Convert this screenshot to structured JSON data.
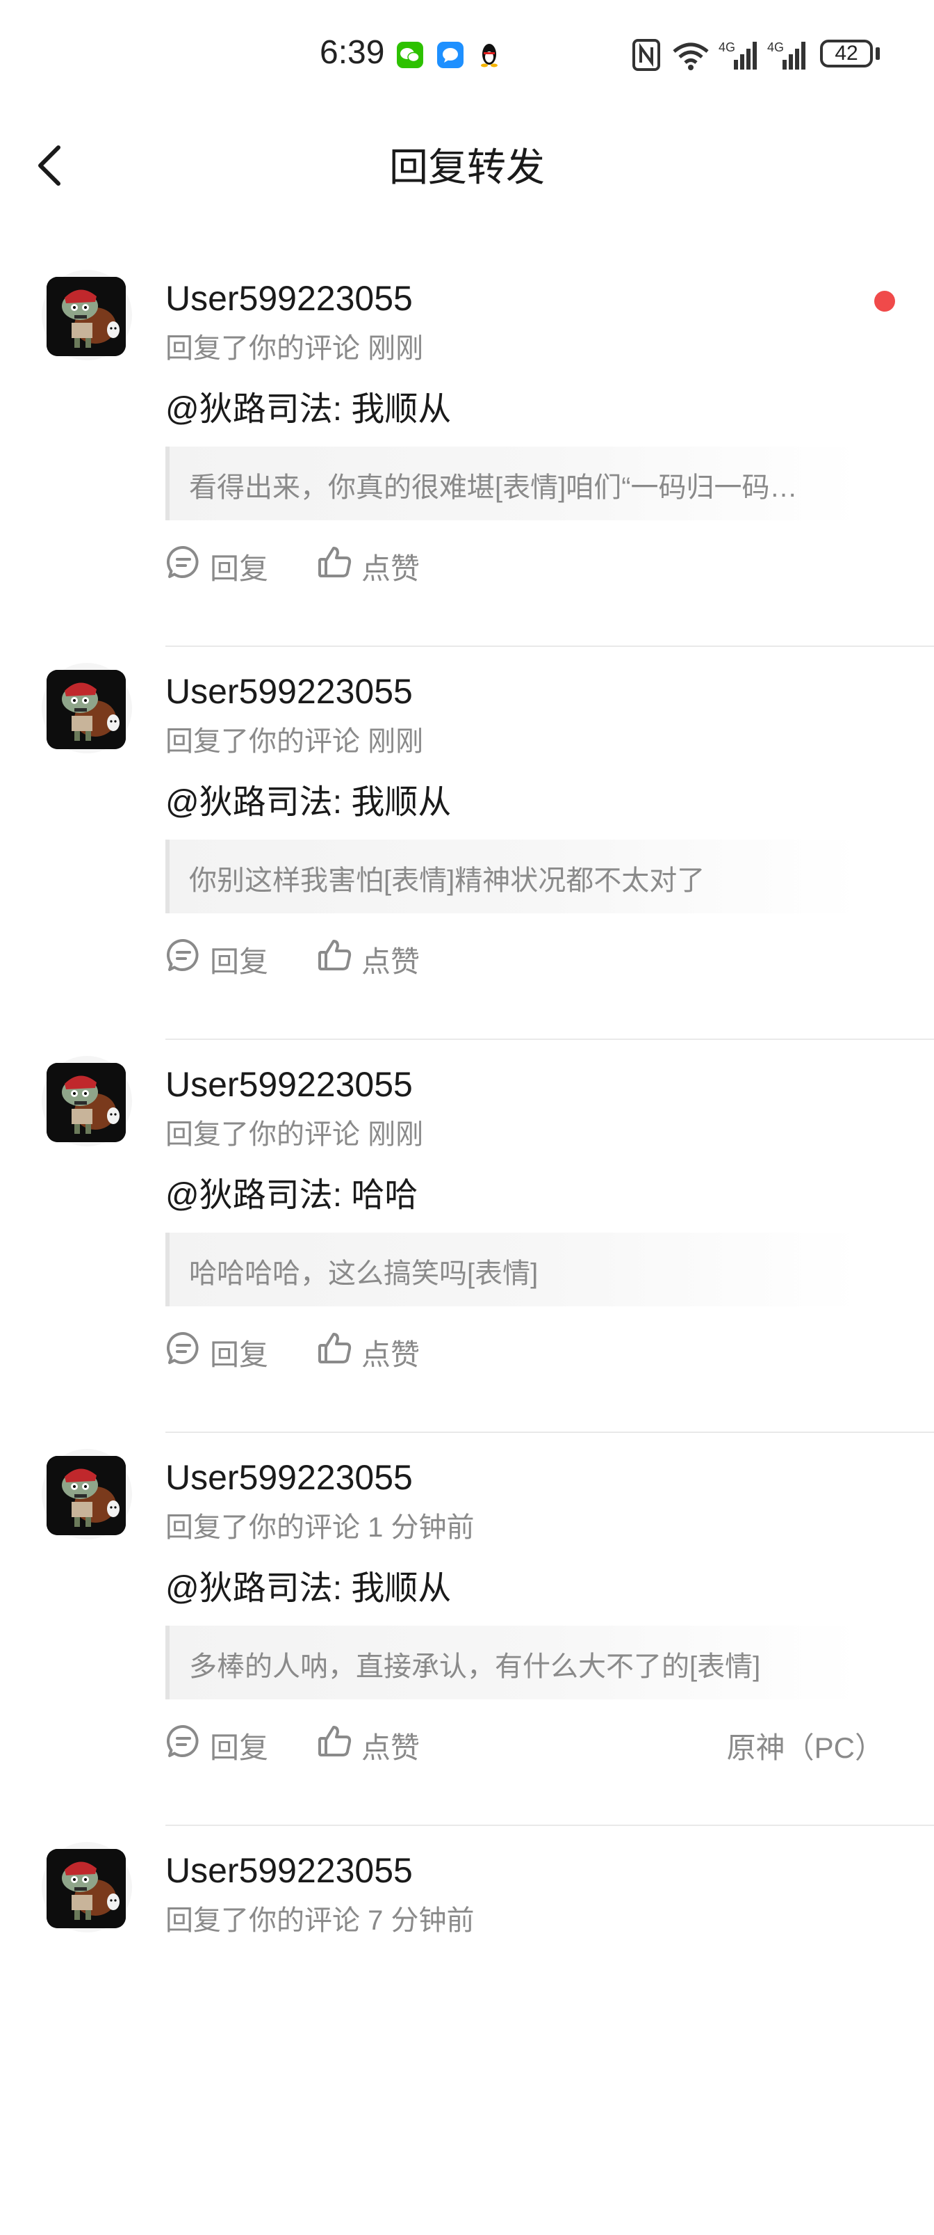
{
  "status_bar": {
    "time": "6:39",
    "battery": "42",
    "network": "4G"
  },
  "header": {
    "title": "回复转发"
  },
  "items": [
    {
      "username": "User599223055",
      "meta": "回复了你的评论 刚刚",
      "reply": "@狄路司法: 我顺从",
      "quote": "看得出来，你真的很难堪[表情]咱们“一码归一码…",
      "reply_label": "回复",
      "like_label": "点赞",
      "source": "",
      "unread": true
    },
    {
      "username": "User599223055",
      "meta": "回复了你的评论 刚刚",
      "reply": "@狄路司法: 我顺从",
      "quote": "你别这样我害怕[表情]精神状况都不太对了",
      "reply_label": "回复",
      "like_label": "点赞",
      "source": "",
      "unread": false
    },
    {
      "username": "User599223055",
      "meta": "回复了你的评论 刚刚",
      "reply": "@狄路司法: 哈哈",
      "quote": "哈哈哈哈，这么搞笑吗[表情]",
      "reply_label": "回复",
      "like_label": "点赞",
      "source": "",
      "unread": false
    },
    {
      "username": "User599223055",
      "meta": "回复了你的评论 1 分钟前",
      "reply": "@狄路司法: 我顺从",
      "quote": "多棒的人呐，直接承认，有什么大不了的[表情]",
      "reply_label": "回复",
      "like_label": "点赞",
      "source": "原神（PC）",
      "unread": false
    },
    {
      "username": "User599223055",
      "meta": "回复了你的评论 7 分钟前",
      "reply": "",
      "quote": "",
      "reply_label": "",
      "like_label": "",
      "source": "",
      "unread": false
    }
  ],
  "icons": {
    "back": "chevron-left-icon",
    "reply": "comment-bubble-icon",
    "like": "thumbs-up-icon",
    "unread": "red-dot"
  },
  "colors": {
    "accent_dot": "#f04a4a",
    "secondary_text": "#8a8a8a",
    "divider": "#e9e9e9"
  }
}
